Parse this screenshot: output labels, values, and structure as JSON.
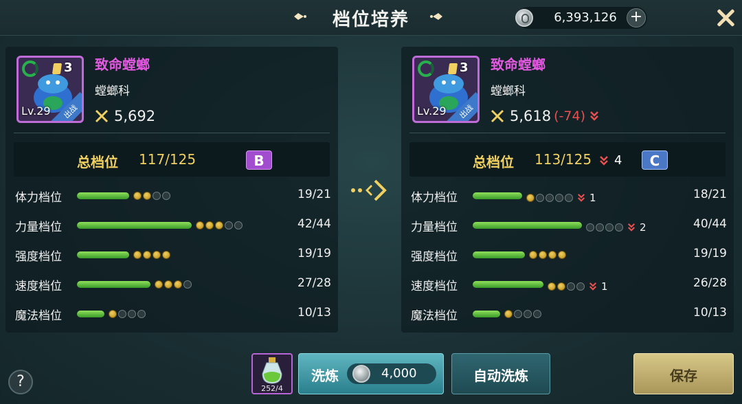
{
  "header": {
    "title": "档位培养",
    "currency_value": "6,393,126",
    "plus_label": "+"
  },
  "left": {
    "name": "致命螳螂",
    "family": "螳螂科",
    "level": "Lv.29",
    "stars": "3",
    "deploy_tag": "出战",
    "power": "5,692",
    "total_label": "总档位",
    "total_value": "117/125",
    "grade": "B",
    "stats": [
      {
        "label": "体力档位",
        "value": "19/21",
        "dots_filled": 2,
        "dots_empty": 2
      },
      {
        "label": "力量档位",
        "value": "42/44",
        "dots_filled": 3,
        "dots_empty": 2
      },
      {
        "label": "强度档位",
        "value": "19/19",
        "dots_filled": 4,
        "dots_empty": 0
      },
      {
        "label": "速度档位",
        "value": "27/28",
        "dots_filled": 3,
        "dots_empty": 1
      },
      {
        "label": "魔法档位",
        "value": "10/13",
        "dots_filled": 1,
        "dots_empty": 3
      }
    ]
  },
  "right": {
    "name": "致命螳螂",
    "family": "螳螂科",
    "level": "Lv.29",
    "stars": "3",
    "deploy_tag": "出战",
    "power": "5,618",
    "power_diff": "(-74)",
    "total_label": "总档位",
    "total_value": "113/125",
    "total_down": "4",
    "grade": "C",
    "stats": [
      {
        "label": "体力档位",
        "value": "18/21",
        "dots_filled": 1,
        "dots_empty": 4,
        "down": "1"
      },
      {
        "label": "力量档位",
        "value": "40/44",
        "dots_filled": 0,
        "dots_empty": 4,
        "down": "2"
      },
      {
        "label": "强度档位",
        "value": "19/19",
        "dots_filled": 4,
        "dots_empty": 0
      },
      {
        "label": "速度档位",
        "value": "26/28",
        "dots_filled": 2,
        "dots_empty": 2,
        "down": "1"
      },
      {
        "label": "魔法档位",
        "value": "10/13",
        "dots_filled": 1,
        "dots_empty": 3
      }
    ]
  },
  "bottom": {
    "help": "?",
    "potion_count": "252/4",
    "refine_label": "洗炼",
    "refine_cost": "4,000",
    "auto_label": "自动洗炼",
    "save_label": "保存"
  },
  "colors": {
    "grade_b": "#a24dd0",
    "grade_c": "#4b77c7",
    "bar": "#5bbf3c",
    "down": "#e85050"
  }
}
